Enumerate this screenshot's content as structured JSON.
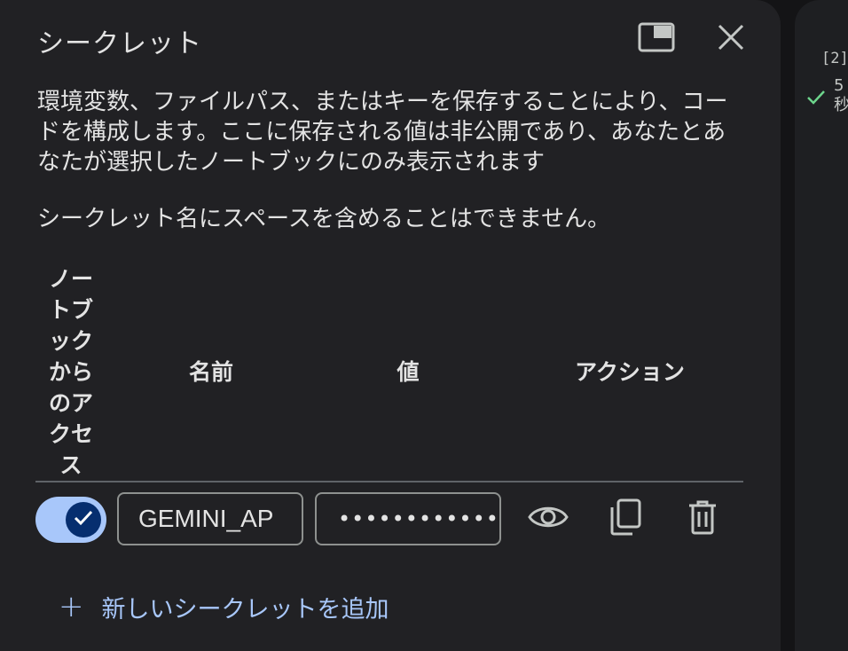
{
  "dialog": {
    "title": "シークレット",
    "description": "環境変数、ファイルパス、またはキーを保存することにより、コードを構成します。ここに保存される値は非公開であり、あなたとあなたが選択したノートブックにのみ表示されます",
    "note": "シークレット名にスペースを含めることはできません。",
    "header_icons": [
      "open-in-tab-icon",
      "close-icon"
    ]
  },
  "table": {
    "headers": {
      "access": "ノートブックからのアクセス",
      "name": "名前",
      "value": "値",
      "actions": "アクション"
    },
    "rows": [
      {
        "access_enabled": true,
        "name": "GEMINI_AP",
        "value": "••••••••••••••",
        "actions": [
          "visibility-icon",
          "copy-icon",
          "delete-icon"
        ]
      }
    ]
  },
  "add_secret_label": "新しいシークレットを追加",
  "notebook": {
    "cell_index": "[2]",
    "exec_time": "5 秒"
  },
  "colors": {
    "panel_bg": "#212124",
    "accent": "#a8c7fa",
    "check_green": "#6dd58c"
  }
}
